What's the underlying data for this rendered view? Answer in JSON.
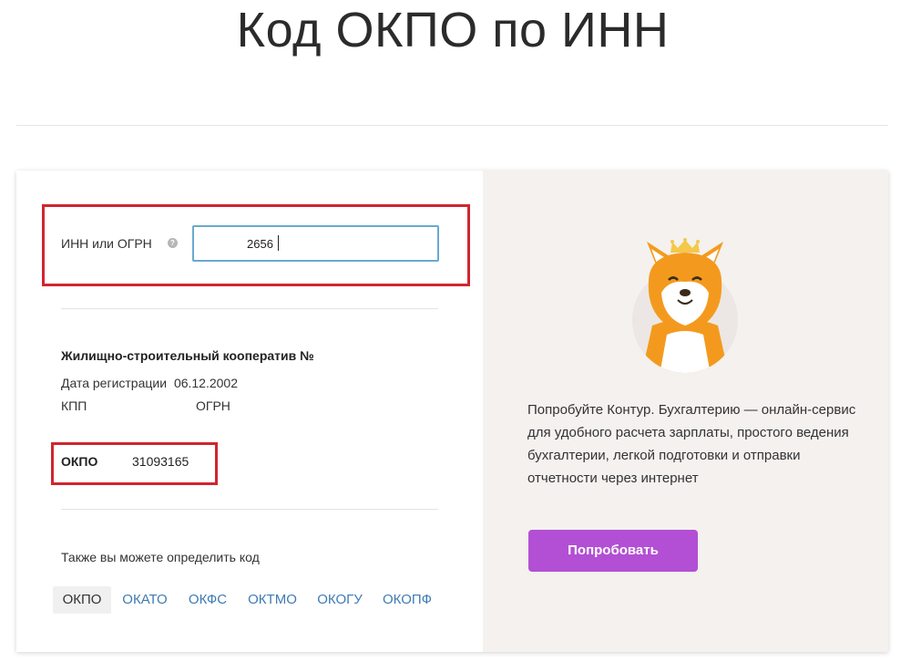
{
  "page": {
    "title": "Код ОКПО по ИНН"
  },
  "search": {
    "label": "ИНН или ОГРН",
    "help_icon": "question-circle-icon",
    "value": "2656"
  },
  "result": {
    "org_name": "Жилищно-строительный кооператив №",
    "reg_date_label": "Дата регистрации",
    "reg_date": "06.12.2002",
    "kpp_label": "КПП",
    "ogrn_label": "ОГРН",
    "okpo_label": "ОКПО",
    "okpo_value": "31093165"
  },
  "codes": {
    "intro": "Также вы можете определить код",
    "tabs": [
      "ОКПО",
      "ОКАТО",
      "ОКФС",
      "ОКТМО",
      "ОКОГУ",
      "ОКОПФ"
    ],
    "active": "ОКПО"
  },
  "promo": {
    "text": "Попробуйте Контур. Бухгалтерию — онлайн-сервис для удобного расчета зарплаты, простого ведения бухгалтерии, легкой подготовки и отправки отчетности через интернет",
    "button_label": "Попробовать",
    "mascot": "shiba-dog-with-crown-icon"
  },
  "colors": {
    "highlight": "#d1252f",
    "link": "#3f7bb5",
    "button": "#b24fd4",
    "input_border": "#6aa9cf",
    "right_panel": "#f4f1ef"
  }
}
